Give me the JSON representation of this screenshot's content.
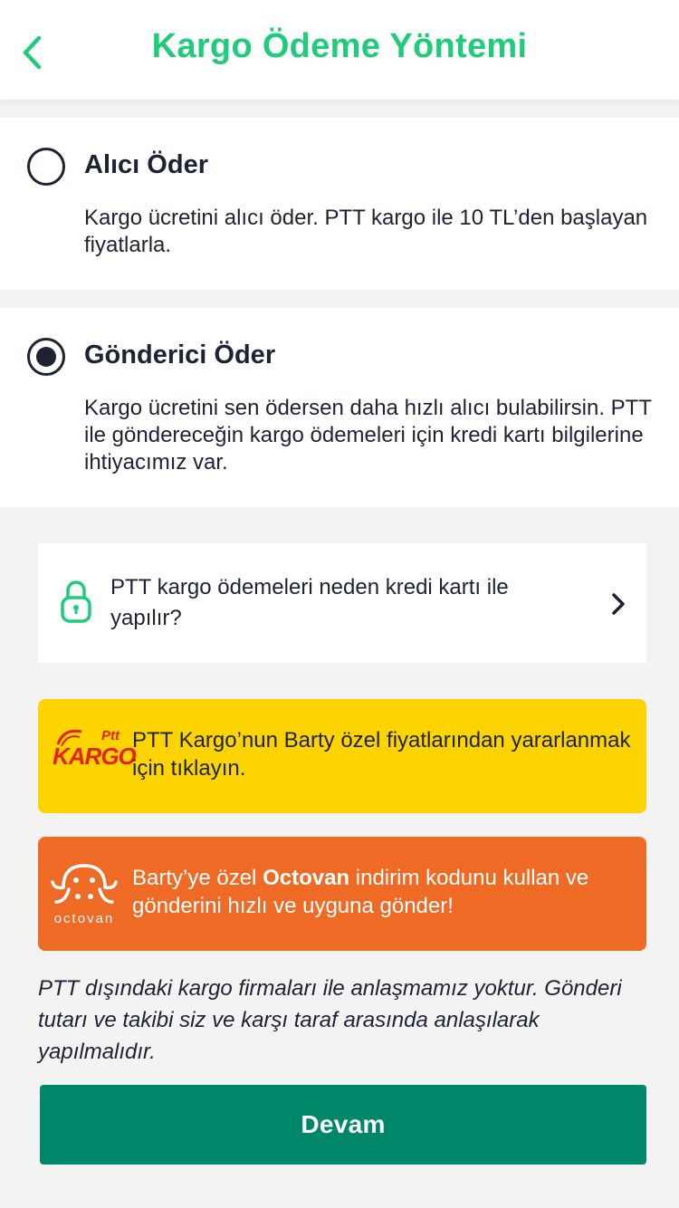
{
  "header": {
    "title": "Kargo Ödeme Yöntemi",
    "back_icon": "chevron-left-icon"
  },
  "options": [
    {
      "title": "Alıcı Öder",
      "description": "Kargo ücretini alıcı öder. PTT kargo ile 10 TL’den başlayan fiyatlarla.",
      "selected": false
    },
    {
      "title": "Gönderici Öder",
      "description": "Kargo ücretini sen ödersen daha hızlı alıcı bulabilirsin. PTT ile göndereceğin kargo ödemeleri için kredi kartı bilgilerine ihtiyacımız var.",
      "selected": true
    }
  ],
  "info_card": {
    "text": "PTT kargo ödemeleri neden kredi kartı ile yapılır?",
    "icon": "lock-icon"
  },
  "ptt_banner": {
    "logo_small": "Ptt",
    "logo_main": "KARGO",
    "text": "PTT Kargo’nun Barty özel fiyatlarından yararlanmak için tıklayın."
  },
  "octovan_banner": {
    "logo_word": "octovan",
    "text_before": "Barty’ye özel ",
    "text_bold": "Octovan",
    "text_after": " indirim kodunu kullan ve gönderini hızlı ve uyguna gönder!"
  },
  "disclaimer": "PTT dışındaki kargo firmaları ile anlaşmamız yoktur. Gönderi tutarı ve takibi siz ve karşı taraf arasında anlaşılarak yapılmalıdır.",
  "continue_button": "Devam",
  "colors": {
    "accent_green": "#1fcc79",
    "button_green": "#00876a",
    "ptt_yellow": "#fdd400",
    "octovan_orange": "#ef6a25",
    "text_dark": "#1e2333"
  }
}
